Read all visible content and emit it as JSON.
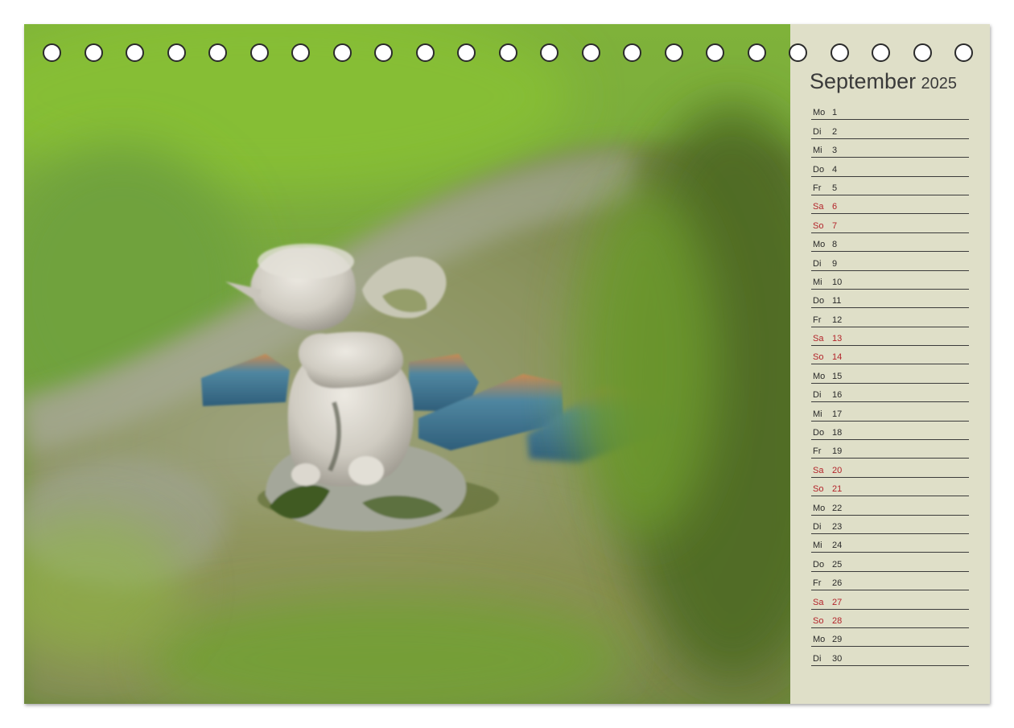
{
  "calendar": {
    "month": "September",
    "year": "2025",
    "weekend_color": "#b3232a",
    "ring_count": 23,
    "photo_subject": "stone-cherub-figurine",
    "days": [
      {
        "wd": "Mo",
        "d": "1",
        "weekend": false
      },
      {
        "wd": "Di",
        "d": "2",
        "weekend": false
      },
      {
        "wd": "Mi",
        "d": "3",
        "weekend": false
      },
      {
        "wd": "Do",
        "d": "4",
        "weekend": false
      },
      {
        "wd": "Fr",
        "d": "5",
        "weekend": false
      },
      {
        "wd": "Sa",
        "d": "6",
        "weekend": true
      },
      {
        "wd": "So",
        "d": "7",
        "weekend": true
      },
      {
        "wd": "Mo",
        "d": "8",
        "weekend": false
      },
      {
        "wd": "Di",
        "d": "9",
        "weekend": false
      },
      {
        "wd": "Mi",
        "d": "10",
        "weekend": false
      },
      {
        "wd": "Do",
        "d": "11",
        "weekend": false
      },
      {
        "wd": "Fr",
        "d": "12",
        "weekend": false
      },
      {
        "wd": "Sa",
        "d": "13",
        "weekend": true
      },
      {
        "wd": "So",
        "d": "14",
        "weekend": true
      },
      {
        "wd": "Mo",
        "d": "15",
        "weekend": false
      },
      {
        "wd": "Di",
        "d": "16",
        "weekend": false
      },
      {
        "wd": "Mi",
        "d": "17",
        "weekend": false
      },
      {
        "wd": "Do",
        "d": "18",
        "weekend": false
      },
      {
        "wd": "Fr",
        "d": "19",
        "weekend": false
      },
      {
        "wd": "Sa",
        "d": "20",
        "weekend": true
      },
      {
        "wd": "So",
        "d": "21",
        "weekend": true
      },
      {
        "wd": "Mo",
        "d": "22",
        "weekend": false
      },
      {
        "wd": "Di",
        "d": "23",
        "weekend": false
      },
      {
        "wd": "Mi",
        "d": "24",
        "weekend": false
      },
      {
        "wd": "Do",
        "d": "25",
        "weekend": false
      },
      {
        "wd": "Fr",
        "d": "26",
        "weekend": false
      },
      {
        "wd": "Sa",
        "d": "27",
        "weekend": true
      },
      {
        "wd": "So",
        "d": "28",
        "weekend": true
      },
      {
        "wd": "Mo",
        "d": "29",
        "weekend": false
      },
      {
        "wd": "Di",
        "d": "30",
        "weekend": false
      }
    ]
  }
}
